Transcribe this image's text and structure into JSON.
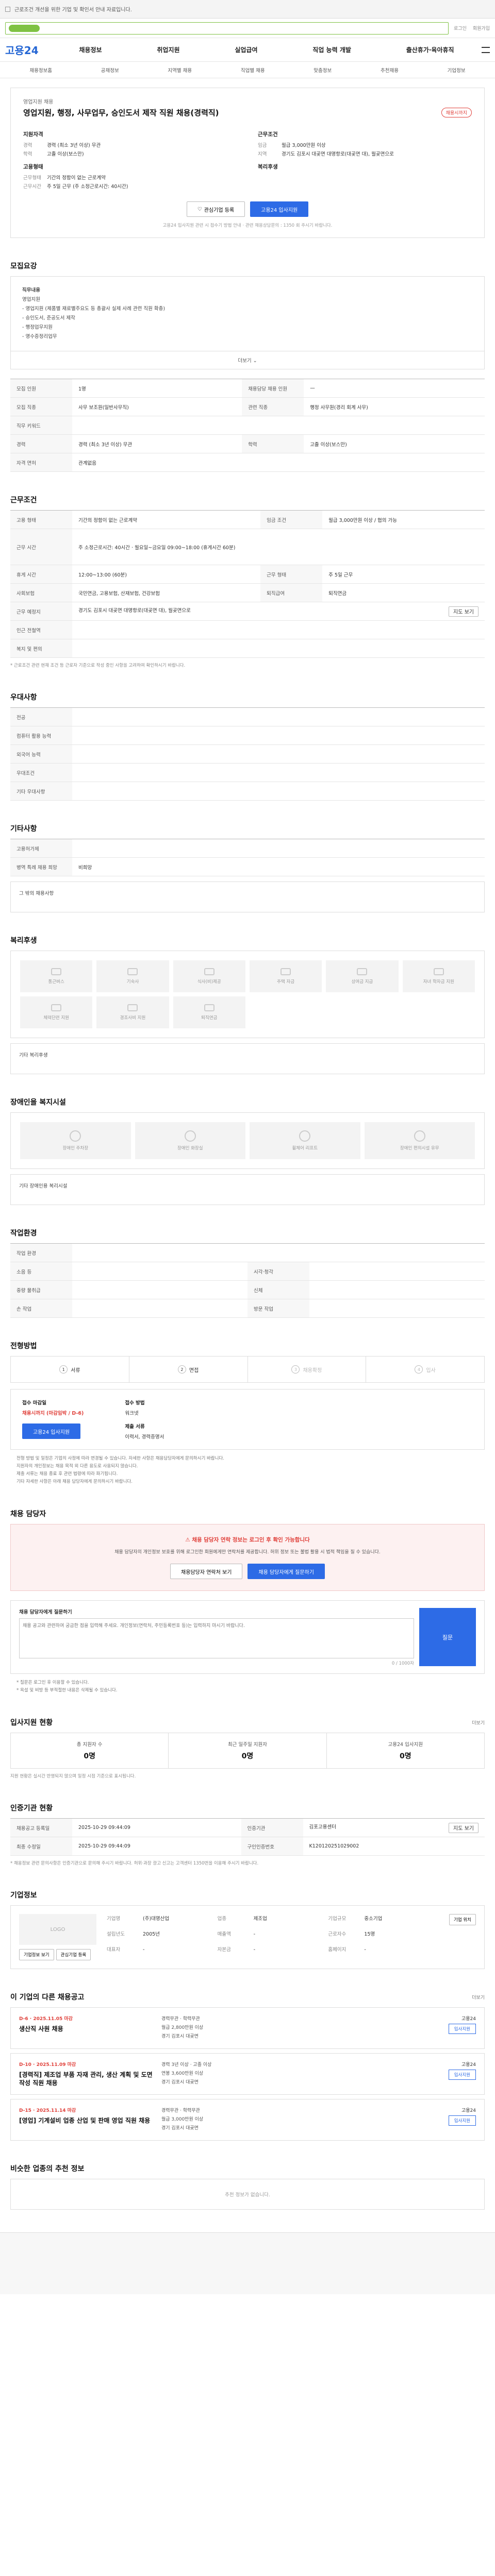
{
  "topbar": {
    "notice": "근로조건 개선을 위한 기업 및 확인서 안내 자료입니다."
  },
  "header": {
    "logo_text": "고용24",
    "search_placeholder": "",
    "links": [
      "로그인",
      "회원가입"
    ],
    "gnb": [
      "채용정보",
      "취업지원",
      "실업급여",
      "직업 능력 개발",
      "출산휴가·육아휴직"
    ],
    "gnb2": [
      "채용정보홈",
      "공채정보",
      "지역별 채용",
      "직업별 채용",
      "맞춤정보",
      "추천채용",
      "기업정보"
    ]
  },
  "job": {
    "company": "영업지원 채용",
    "title": "영업지원, 행정, 사무업무, 승인도서 제작 직원 채용(경력직)",
    "badge": "채용시까지",
    "left_title": "지원자격",
    "left_rows": [
      {
        "k": "경력",
        "v": "경력 (최소 3년 이상) 무관"
      },
      {
        "k": "학력",
        "v": "고졸 이상(보스만)"
      }
    ],
    "left_title2": "고용형태",
    "left_rows2": [
      {
        "k": "근무형태",
        "v": "기간의 정함이 없는 근로계약"
      },
      {
        "k": "근무시간",
        "v": "주 5일 근무 (주 소정근로시간: 40시간)"
      }
    ],
    "right_title": "근무조건",
    "right_rows": [
      {
        "k": "임금",
        "v": "월급 3,000만원 이상"
      },
      {
        "k": "지역",
        "v": "경기도 김포시 대곶면 대명항로(대곶면 대), 월곶면으로"
      }
    ],
    "right_title2": "복리후생",
    "btn_interest": "관심기업 등록",
    "btn_apply": "고용24 입사지원",
    "btn_note": "고용24 입사지원 관련 시 접수기 방법 안내 · 관련 채용상담문의 : 1350 회 주시기 바랍니다."
  },
  "desc": {
    "title": "모집요강",
    "lines": [
      "직무내용",
      "영업지원",
      "- 영업지원 (제품별 재료별주요도 등 총괄사 실제 사례 관련 직원 확충)",
      "- 승인도서, 준공도서 제작",
      "- 행정업무지원",
      "- 영수증정리업무"
    ],
    "more": "더보기",
    "rows": [
      {
        "k": "모집 인원",
        "v": "1명",
        "k2": "채용담당 채용 인원",
        "v2": "—"
      },
      {
        "k": "모집 직종",
        "v": "사무 보조원(일반사무직)",
        "k2": "관련 직종",
        "v2": "행정 사무원(경리 회계 사무)"
      },
      {
        "k": "직무 키워드",
        "v": "",
        "k2": "",
        "v2": ""
      },
      {
        "k": "경력",
        "v": "경력 (최소 3년 이상) 무관",
        "k2": "학력",
        "v2": "고졸 이상(보스만)"
      },
      {
        "k": "자격 면허",
        "v": "관계없음",
        "k2": "",
        "v2": ""
      }
    ]
  },
  "cond": {
    "title": "근무조건",
    "rows": [
      {
        "k": "고용 형태",
        "v": "기간의 정함이 없는 근로계약",
        "k2": "임금 조건",
        "v2": "월급 3,000만원 이상 / 협의 가능"
      },
      {
        "k": "근무 시간",
        "v": "주 소정근로시간: 40시간 · 월요일~금요일 09:00~18:00 (휴게시간 60분)",
        "k2": "",
        "v2": ""
      },
      {
        "k": "휴게 시간",
        "v": "12:00~13:00 (60분)",
        "k2": "근무 형태",
        "v2": "주 5일 근무"
      },
      {
        "k": "사회보험",
        "v": "국민연금, 고용보험, 산재보험, 건강보험",
        "k2": "퇴직급여",
        "v2": "퇴직연금"
      },
      {
        "k": "근무 예정지",
        "v": "경기도 김포시 대곶면 대명항로(대곶면 대), 월곶면으로",
        "k2": "",
        "v2": ""
      },
      {
        "k": "인근 전철역",
        "v": "",
        "k2": "",
        "v2": ""
      },
      {
        "k": "복지 및 편의",
        "v": "",
        "k2": "",
        "v2": ""
      }
    ],
    "map_btn": "지도 보기",
    "note": "* 근로조건 관련 현재 조건 등 근로자 기준으로 작성 중인 사항을 고려하여 확인하시기 바랍니다."
  },
  "pref": {
    "title": "우대사항",
    "rows": [
      {
        "k": "전공",
        "v": ""
      },
      {
        "k": "컴퓨터 활용 능력",
        "v": ""
      },
      {
        "k": "외국어 능력",
        "v": ""
      },
      {
        "k": "우대조건",
        "v": ""
      },
      {
        "k": "기타 우대사항",
        "v": ""
      }
    ]
  },
  "etc": {
    "title": "기타사항",
    "rows": [
      {
        "k": "고용허가제",
        "v": ""
      },
      {
        "k": "병역 특례 채용 희망",
        "v": "비희망"
      }
    ],
    "extra_label": "그 밖의 채용사항"
  },
  "welfare": {
    "title": "복리후생",
    "items": [
      "통근버스",
      "기숙사",
      "식사(비)제공",
      "주택 자금",
      "상여금 지급",
      "자녀 학자금 지원",
      "체력단련 지원",
      "경조사비 지원",
      "퇴직연금"
    ],
    "extra_label": "기타 복리후생"
  },
  "disability": {
    "title": "장애인을 복지시설",
    "items": [
      "장애인 주차장",
      "장애인 화장실",
      "휠체어 리프트",
      "장애인 편의시설 유무"
    ],
    "extra_label": "기타 장애인용 복리시설"
  },
  "workenv": {
    "title": "작업환경",
    "rows": [
      {
        "k": "작업 환경",
        "v": "",
        "k2": "",
        "v2": ""
      },
      {
        "k": "소음 등",
        "v": "",
        "k2": "시각·청각",
        "v2": ""
      },
      {
        "k": "중량 물취급",
        "v": "",
        "k2": "신체",
        "v2": ""
      },
      {
        "k": "손 작업",
        "v": "",
        "k2": "방문 작업",
        "v2": ""
      }
    ]
  },
  "process": {
    "title": "전형방법",
    "steps": [
      "서류",
      "면접",
      "채용확정",
      "입사"
    ],
    "label1": "접수 마감일",
    "deadline": "채용시까지 (마감임박 / D-6)",
    "label2": "접수 방법",
    "method": "워크넷",
    "apply_btn": "고용24 입사지원",
    "label3": "제출 서류",
    "docs": "이력서, 경력증명서",
    "notes": [
      "전형 방법 및 일정은 기업의 사정에 따라 변경될 수 있습니다. 자세한 사항은 채용담당자에게 문의하시기 바랍니다.",
      "지원자의 개인정보는 채용 목적 외 다른 용도로 사용되지 않습니다.",
      "제출 서류는 채용 종료 후 관련 법령에 따라 파기됩니다.",
      "기타 자세한 사항은 아래 채용 담당자에게 문의하시기 바랍니다."
    ]
  },
  "contact": {
    "title": "채용 담당자",
    "warn": "채용 담당자 연락 정보는 로그인 후 확인 가능합니다",
    "desc": "채용 담당자의 개인정보 보호를 위해 로그인한 회원에게만 연락처를 제공합니다. 허위 정보 또는 불법 활용 시 법적 책임을 질 수 있습니다.",
    "btn1": "채용담당자 연락처 보기",
    "btn2": "채용 담당자에게 질문하기",
    "q_label": "채용 담당자에게 질문하기",
    "q_placeholder": "채용 공고와 관련하여 궁금한 점을 입력해 주세요. 개인정보(연락처, 주민등록번호 등)는 입력하지 마시기 바랍니다.",
    "q_count": "0 / 1000자",
    "q_send": "질문",
    "q_notes": [
      "* 질문은 로그인 후 이용할 수 있습니다.",
      "* 욕설 및 비방 등 부적절한 내용은 삭제될 수 있습니다."
    ]
  },
  "stats": {
    "title": "입사지원 현황",
    "more": "더보기",
    "items": [
      {
        "label": "총 지원자 수",
        "num": "0명"
      },
      {
        "label": "최근 일주일 지원자",
        "num": "0명"
      },
      {
        "label": "고용24 입사지원",
        "num": "0명"
      }
    ],
    "note": "지원 현황은 실시간 반영되지 않으며 일정 시점 기준으로 표시됩니다."
  },
  "info": {
    "title": "인증기관 현황",
    "rows": [
      {
        "k": "채용공고 등록일",
        "v": "2025-10-29 09:44:09",
        "k2": "인증기관",
        "v2": "김포고용센터"
      },
      {
        "k": "최종 수정일",
        "v": "2025-10-29 09:44:09",
        "k2": "구인인증번호",
        "v2": "K120120251029002"
      }
    ],
    "btn": "지도 보기",
    "note": "* 채용정보 관련 문의사항은 인증기관으로 문의해 주시기 바랍니다. 허위·과장 광고 신고는 고객센터 1350번을 이용해 주시기 바랍니다."
  },
  "company": {
    "title": "기업정보",
    "logo": "LOGO",
    "btn1": "기업정보 보기",
    "btn2": "관심기업 등록",
    "rows": [
      {
        "k": "기업명",
        "v": "(주)대명산업"
      },
      {
        "k": "업종",
        "v": "제조업"
      },
      {
        "k": "기업규모",
        "v": "중소기업"
      },
      {
        "k": "설립년도",
        "v": "2005년"
      },
      {
        "k": "매출액",
        "v": "-"
      },
      {
        "k": "근로자수",
        "v": "15명"
      },
      {
        "k": "대표자",
        "v": "-"
      },
      {
        "k": "자본금",
        "v": "-"
      },
      {
        "k": "홈페이지",
        "v": "-"
      }
    ],
    "map_btn": "기업 위치"
  },
  "others": {
    "title": "이 기업의 다른 채용공고",
    "more": "더보기",
    "jobs": [
      {
        "date": "D-6 · 2025.11.05 마감",
        "title": "생산직 사원 채용",
        "info": [
          "경력무관 · 학력무관",
          "월급 2,800만원 이상",
          "경기 김포시 대곶면"
        ],
        "tag": "고용24"
      },
      {
        "date": "D-10 · 2025.11.09 마감",
        "title": "[경력직] 제조업 부품 자재 관리, 생산 계획 및 도면 작성 직원 채용",
        "info": [
          "경력 3년 이상 · 고졸 이상",
          "연봉 3,600만원 이상",
          "경기 김포시 대곶면"
        ],
        "tag": "고용24"
      },
      {
        "date": "D-15 · 2025.11.14 마감",
        "title": "[영업] 기계설비 업종 산업 및 판매 영업 직원 채용",
        "info": [
          "경력무관 · 학력무관",
          "월급 3,000만원 이상",
          "경기 김포시 대곶면"
        ],
        "tag": "고용24"
      }
    ],
    "btn": "입사지원"
  },
  "similar": {
    "title": "비슷한 업종의 추천 정보",
    "empty": "추천 정보가 없습니다."
  },
  "colors": {
    "brand": "#2466d4",
    "accent": "#2d6be6",
    "alert": "#e0403a",
    "green": "#7fc243"
  }
}
